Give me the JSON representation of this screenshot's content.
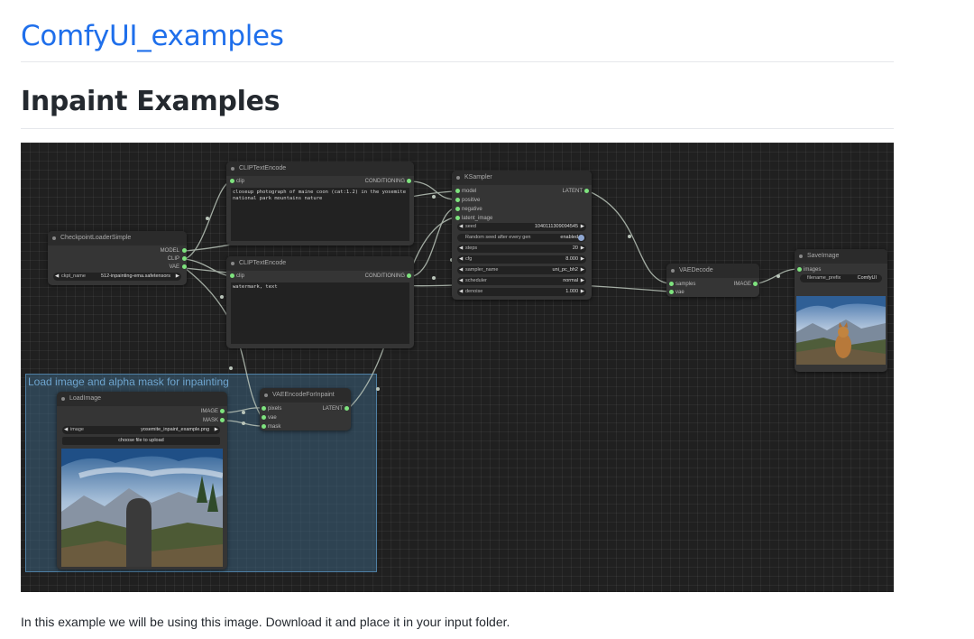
{
  "site_title": "ComfyUI_examples",
  "page_title": "Inpaint Examples",
  "caption": "In this example we will be using this image. Download it and place it in your input folder.",
  "workflow": {
    "group_title": "Load image and alpha mask for inpainting",
    "checkpoint": {
      "title": "CheckpointLoaderSimple",
      "outputs": [
        "MODEL",
        "CLIP",
        "VAE"
      ],
      "ckpt_label": "ckpt_name",
      "ckpt_value": "512-inpainting-ema.safetensors"
    },
    "clip_pos": {
      "title": "CLIPTextEncode",
      "input": "clip",
      "output": "CONDITIONING",
      "text": "closeup photograph of maine coon (cat:1.2) in the yosemite national park mountains nature"
    },
    "clip_neg": {
      "title": "CLIPTextEncode",
      "input": "clip",
      "output": "CONDITIONING",
      "text": "watermark, text"
    },
    "ksampler": {
      "title": "KSampler",
      "inputs": [
        "model",
        "positive",
        "negative",
        "latent_image"
      ],
      "output": "LATENT",
      "widgets": {
        "seed_label": "seed",
        "seed_value": "1040111309094545",
        "rand_label": "Random seed after every gen",
        "rand_value": "enabled",
        "steps_label": "steps",
        "steps_value": "20",
        "cfg_label": "cfg",
        "cfg_value": "8.000",
        "sampler_label": "sampler_name",
        "sampler_value": "uni_pc_bh2",
        "scheduler_label": "scheduler",
        "scheduler_value": "normal",
        "denoise_label": "denoise",
        "denoise_value": "1.000"
      }
    },
    "vae_decode": {
      "title": "VAEDecode",
      "inputs": [
        "samples",
        "vae"
      ],
      "output": "IMAGE"
    },
    "save_image": {
      "title": "SaveImage",
      "input": "images",
      "prefix_label": "filename_prefix",
      "prefix_value": "ComfyUI"
    },
    "load_image": {
      "title": "LoadImage",
      "outputs": [
        "IMAGE",
        "MASK"
      ],
      "image_label": "image",
      "image_value": "yosemite_inpaint_example.png",
      "upload_label": "choose file to upload"
    },
    "vae_encode": {
      "title": "VAEEncodeForInpaint",
      "inputs": [
        "pixels",
        "vae",
        "mask"
      ],
      "output": "LATENT"
    }
  },
  "colors": {
    "link_blue": "#1f6feb",
    "canvas_bg": "#202020",
    "node_bg": "#353535",
    "slot_green": "#7ee37e",
    "group_blue": "#3a607c"
  }
}
